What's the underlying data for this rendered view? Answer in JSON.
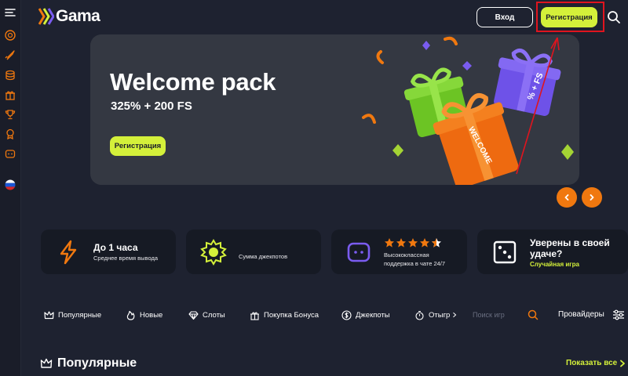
{
  "header": {
    "logo_text": "Gama",
    "login_label": "Вход",
    "register_label": "Регистрация"
  },
  "sidebar": {
    "icons": [
      "menu-icon",
      "coin-icon",
      "rocket-icon",
      "coins-stack-icon",
      "gift-icon",
      "trophy-icon",
      "award-icon",
      "chat-icon",
      "russian-flag-icon"
    ]
  },
  "banner": {
    "title": "Welcome pack",
    "subtitle": "325% + 200 FS",
    "button_label": "Регистрация",
    "gift_text_1": "WELCOME",
    "gift_text_2": "% + FS"
  },
  "features": [
    {
      "title": "До 1 часа",
      "subtitle": "Среднее время вывода"
    },
    {
      "title": "",
      "subtitle": "Сумма джекпотов"
    },
    {
      "title": "",
      "subtitle_line1": "Высококлассная",
      "subtitle_line2": "поддержка в чате 24/7"
    },
    {
      "title_line1": "Уверены в своей",
      "title_line2": "удаче?",
      "link": "Случайная игра"
    }
  ],
  "tabs": [
    {
      "label": "Популярные",
      "icon": "crown-icon"
    },
    {
      "label": "Новые",
      "icon": "flame-icon"
    },
    {
      "label": "Слоты",
      "icon": "diamond-icon"
    },
    {
      "label": "Покупка Бонуса",
      "icon": "gift-icon"
    },
    {
      "label": "Джекпоты",
      "icon": "dollar-coin-icon"
    },
    {
      "label": "Отыгр",
      "icon": "timer-icon"
    }
  ],
  "search_placeholder": "Поиск игр",
  "providers_label": "Провайдеры",
  "section": {
    "title": "Популярные",
    "show_all": "Показать все"
  },
  "colors": {
    "accent": "#d4f03a",
    "orange": "#f0780f",
    "background": "#1e2230",
    "card": "#161a24",
    "banner": "#343842",
    "highlight": "#e0141e"
  }
}
